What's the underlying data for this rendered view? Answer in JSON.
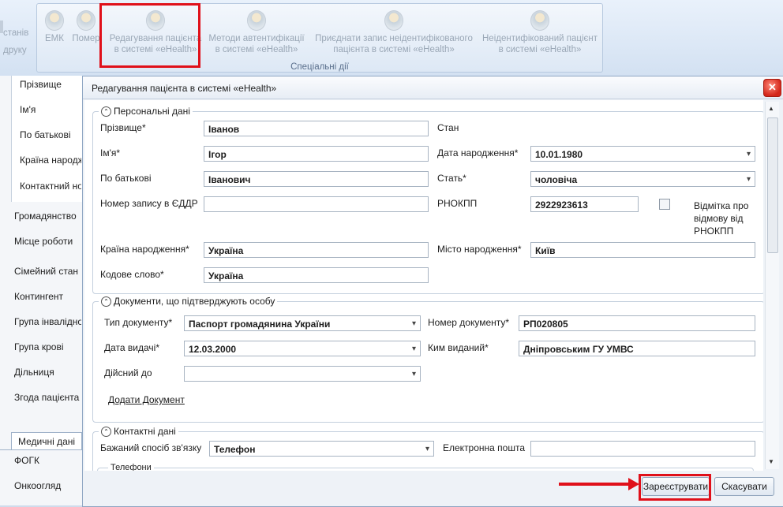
{
  "ribbon": {
    "left_partial": [
      "станів",
      "друку"
    ],
    "buttons": [
      {
        "l1": "ЕМК",
        "l2": ""
      },
      {
        "l1": "Помер",
        "l2": ""
      },
      {
        "l1": "Редагування пацієнта",
        "l2": "в системі «eHealth»"
      },
      {
        "l1": "Методи автентифікації",
        "l2": "в системі «eHealth»"
      },
      {
        "l1": "Приєднати запис неідентифікованого",
        "l2": "пацієнта в системі «eHealth»"
      },
      {
        "l1": "Неідентифікований пацієнт",
        "l2": "в системі «eHealth»"
      }
    ],
    "group_caption": "Спеціальні дії"
  },
  "sidebar": {
    "sub_items": [
      "Прізвище",
      "Ім'я",
      "По батькові",
      "Країна народж",
      "Контактний но"
    ],
    "items": [
      "Громадянство",
      "Місце роботи",
      "Сімейний стан",
      "Контингент",
      "Група інвалідно",
      "Група крові",
      "Дільниця",
      "Згода пацієнта"
    ],
    "tab": "Медичні дані",
    "bottom_items": [
      "ФОГК",
      "Онкоогляд"
    ]
  },
  "dialog": {
    "title": "Редагування пацієнта в системі «eHealth»",
    "close": "✕",
    "personal": {
      "header": "Персональні дані",
      "surname_label": "Прізвище*",
      "surname": "Іванов",
      "name_label": "Ім'я*",
      "name": "Ігор",
      "patronymic_label": "По батькові",
      "patronymic": "Іванович",
      "edrr_label": "Номер запису в ЄДДР",
      "edrr": "",
      "country_label": "Країна народження*",
      "country": "Україна",
      "codeword_label": "Кодове слово*",
      "codeword": "Україна",
      "status_label": "Стан",
      "birthdate_label": "Дата народження*",
      "birthdate": "10.01.1980",
      "sex_label": "Стать*",
      "sex": "чоловіча",
      "rnokpp_label": "РНОКПП",
      "rnokpp": "2922923613",
      "refusal_label_1": "Відмітка про",
      "refusal_label_2": "відмову від",
      "refusal_label_3": "РНОКПП",
      "city_label": "Місто народження*",
      "city": "Київ"
    },
    "documents": {
      "header": "Документи, що підтверджують особу",
      "type_label": "Тип документу*",
      "type": "Паспорт громадянина України",
      "issue_label": "Дата видачі*",
      "issue": "12.03.2000",
      "valid_label": "Дійсний до",
      "valid": "",
      "number_label": "Номер документу*",
      "number": "РП020805",
      "issuer_label": "Ким виданий*",
      "issuer": "Дніпровським ГУ УМВС",
      "add_link": "Додати Документ"
    },
    "contacts": {
      "header": "Контактні дані",
      "method_label": "Бажаний спосіб зв'язку",
      "method": "Телефон",
      "email_label": "Електронна пошта",
      "email": "",
      "phones_header": "Телефони"
    },
    "buttons": {
      "register": "Зареєструвати",
      "cancel": "Скасувати"
    }
  },
  "colors": {
    "highlight": "#e0101a",
    "ribbon_bg": "#dde8f5",
    "dialog_bg": "#eef2f7"
  }
}
